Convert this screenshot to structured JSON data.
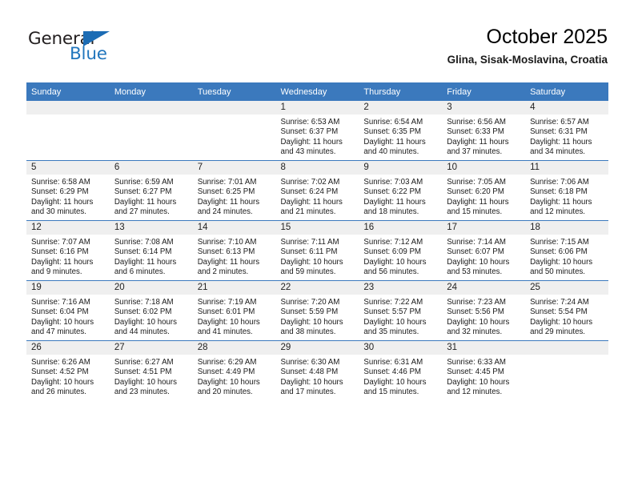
{
  "brand": {
    "name_top": "General",
    "name_bottom": "Blue",
    "color_dark": "#231f20",
    "color_blue": "#2276bd"
  },
  "header": {
    "title": "October 2025",
    "location": "Glina, Sisak-Moslavina, Croatia"
  },
  "theme": {
    "header_bar": "#3b79bd",
    "daynum_band": "#efefef",
    "cell_bg": "#ffffff",
    "row_divider": "#3b79bd"
  },
  "weekday_headers": [
    "Sunday",
    "Monday",
    "Tuesday",
    "Wednesday",
    "Thursday",
    "Friday",
    "Saturday"
  ],
  "weeks": [
    [
      {
        "day": "",
        "sunrise": "",
        "sunset": "",
        "daylight_line1": "",
        "daylight_line2": ""
      },
      {
        "day": "",
        "sunrise": "",
        "sunset": "",
        "daylight_line1": "",
        "daylight_line2": ""
      },
      {
        "day": "",
        "sunrise": "",
        "sunset": "",
        "daylight_line1": "",
        "daylight_line2": ""
      },
      {
        "day": "1",
        "sunrise": "Sunrise: 6:53 AM",
        "sunset": "Sunset: 6:37 PM",
        "daylight_line1": "Daylight: 11 hours",
        "daylight_line2": "and 43 minutes."
      },
      {
        "day": "2",
        "sunrise": "Sunrise: 6:54 AM",
        "sunset": "Sunset: 6:35 PM",
        "daylight_line1": "Daylight: 11 hours",
        "daylight_line2": "and 40 minutes."
      },
      {
        "day": "3",
        "sunrise": "Sunrise: 6:56 AM",
        "sunset": "Sunset: 6:33 PM",
        "daylight_line1": "Daylight: 11 hours",
        "daylight_line2": "and 37 minutes."
      },
      {
        "day": "4",
        "sunrise": "Sunrise: 6:57 AM",
        "sunset": "Sunset: 6:31 PM",
        "daylight_line1": "Daylight: 11 hours",
        "daylight_line2": "and 34 minutes."
      }
    ],
    [
      {
        "day": "5",
        "sunrise": "Sunrise: 6:58 AM",
        "sunset": "Sunset: 6:29 PM",
        "daylight_line1": "Daylight: 11 hours",
        "daylight_line2": "and 30 minutes."
      },
      {
        "day": "6",
        "sunrise": "Sunrise: 6:59 AM",
        "sunset": "Sunset: 6:27 PM",
        "daylight_line1": "Daylight: 11 hours",
        "daylight_line2": "and 27 minutes."
      },
      {
        "day": "7",
        "sunrise": "Sunrise: 7:01 AM",
        "sunset": "Sunset: 6:25 PM",
        "daylight_line1": "Daylight: 11 hours",
        "daylight_line2": "and 24 minutes."
      },
      {
        "day": "8",
        "sunrise": "Sunrise: 7:02 AM",
        "sunset": "Sunset: 6:24 PM",
        "daylight_line1": "Daylight: 11 hours",
        "daylight_line2": "and 21 minutes."
      },
      {
        "day": "9",
        "sunrise": "Sunrise: 7:03 AM",
        "sunset": "Sunset: 6:22 PM",
        "daylight_line1": "Daylight: 11 hours",
        "daylight_line2": "and 18 minutes."
      },
      {
        "day": "10",
        "sunrise": "Sunrise: 7:05 AM",
        "sunset": "Sunset: 6:20 PM",
        "daylight_line1": "Daylight: 11 hours",
        "daylight_line2": "and 15 minutes."
      },
      {
        "day": "11",
        "sunrise": "Sunrise: 7:06 AM",
        "sunset": "Sunset: 6:18 PM",
        "daylight_line1": "Daylight: 11 hours",
        "daylight_line2": "and 12 minutes."
      }
    ],
    [
      {
        "day": "12",
        "sunrise": "Sunrise: 7:07 AM",
        "sunset": "Sunset: 6:16 PM",
        "daylight_line1": "Daylight: 11 hours",
        "daylight_line2": "and 9 minutes."
      },
      {
        "day": "13",
        "sunrise": "Sunrise: 7:08 AM",
        "sunset": "Sunset: 6:14 PM",
        "daylight_line1": "Daylight: 11 hours",
        "daylight_line2": "and 6 minutes."
      },
      {
        "day": "14",
        "sunrise": "Sunrise: 7:10 AM",
        "sunset": "Sunset: 6:13 PM",
        "daylight_line1": "Daylight: 11 hours",
        "daylight_line2": "and 2 minutes."
      },
      {
        "day": "15",
        "sunrise": "Sunrise: 7:11 AM",
        "sunset": "Sunset: 6:11 PM",
        "daylight_line1": "Daylight: 10 hours",
        "daylight_line2": "and 59 minutes."
      },
      {
        "day": "16",
        "sunrise": "Sunrise: 7:12 AM",
        "sunset": "Sunset: 6:09 PM",
        "daylight_line1": "Daylight: 10 hours",
        "daylight_line2": "and 56 minutes."
      },
      {
        "day": "17",
        "sunrise": "Sunrise: 7:14 AM",
        "sunset": "Sunset: 6:07 PM",
        "daylight_line1": "Daylight: 10 hours",
        "daylight_line2": "and 53 minutes."
      },
      {
        "day": "18",
        "sunrise": "Sunrise: 7:15 AM",
        "sunset": "Sunset: 6:06 PM",
        "daylight_line1": "Daylight: 10 hours",
        "daylight_line2": "and 50 minutes."
      }
    ],
    [
      {
        "day": "19",
        "sunrise": "Sunrise: 7:16 AM",
        "sunset": "Sunset: 6:04 PM",
        "daylight_line1": "Daylight: 10 hours",
        "daylight_line2": "and 47 minutes."
      },
      {
        "day": "20",
        "sunrise": "Sunrise: 7:18 AM",
        "sunset": "Sunset: 6:02 PM",
        "daylight_line1": "Daylight: 10 hours",
        "daylight_line2": "and 44 minutes."
      },
      {
        "day": "21",
        "sunrise": "Sunrise: 7:19 AM",
        "sunset": "Sunset: 6:01 PM",
        "daylight_line1": "Daylight: 10 hours",
        "daylight_line2": "and 41 minutes."
      },
      {
        "day": "22",
        "sunrise": "Sunrise: 7:20 AM",
        "sunset": "Sunset: 5:59 PM",
        "daylight_line1": "Daylight: 10 hours",
        "daylight_line2": "and 38 minutes."
      },
      {
        "day": "23",
        "sunrise": "Sunrise: 7:22 AM",
        "sunset": "Sunset: 5:57 PM",
        "daylight_line1": "Daylight: 10 hours",
        "daylight_line2": "and 35 minutes."
      },
      {
        "day": "24",
        "sunrise": "Sunrise: 7:23 AM",
        "sunset": "Sunset: 5:56 PM",
        "daylight_line1": "Daylight: 10 hours",
        "daylight_line2": "and 32 minutes."
      },
      {
        "day": "25",
        "sunrise": "Sunrise: 7:24 AM",
        "sunset": "Sunset: 5:54 PM",
        "daylight_line1": "Daylight: 10 hours",
        "daylight_line2": "and 29 minutes."
      }
    ],
    [
      {
        "day": "26",
        "sunrise": "Sunrise: 6:26 AM",
        "sunset": "Sunset: 4:52 PM",
        "daylight_line1": "Daylight: 10 hours",
        "daylight_line2": "and 26 minutes."
      },
      {
        "day": "27",
        "sunrise": "Sunrise: 6:27 AM",
        "sunset": "Sunset: 4:51 PM",
        "daylight_line1": "Daylight: 10 hours",
        "daylight_line2": "and 23 minutes."
      },
      {
        "day": "28",
        "sunrise": "Sunrise: 6:29 AM",
        "sunset": "Sunset: 4:49 PM",
        "daylight_line1": "Daylight: 10 hours",
        "daylight_line2": "and 20 minutes."
      },
      {
        "day": "29",
        "sunrise": "Sunrise: 6:30 AM",
        "sunset": "Sunset: 4:48 PM",
        "daylight_line1": "Daylight: 10 hours",
        "daylight_line2": "and 17 minutes."
      },
      {
        "day": "30",
        "sunrise": "Sunrise: 6:31 AM",
        "sunset": "Sunset: 4:46 PM",
        "daylight_line1": "Daylight: 10 hours",
        "daylight_line2": "and 15 minutes."
      },
      {
        "day": "31",
        "sunrise": "Sunrise: 6:33 AM",
        "sunset": "Sunset: 4:45 PM",
        "daylight_line1": "Daylight: 10 hours",
        "daylight_line2": "and 12 minutes."
      },
      {
        "day": "",
        "sunrise": "",
        "sunset": "",
        "daylight_line1": "",
        "daylight_line2": ""
      }
    ]
  ]
}
